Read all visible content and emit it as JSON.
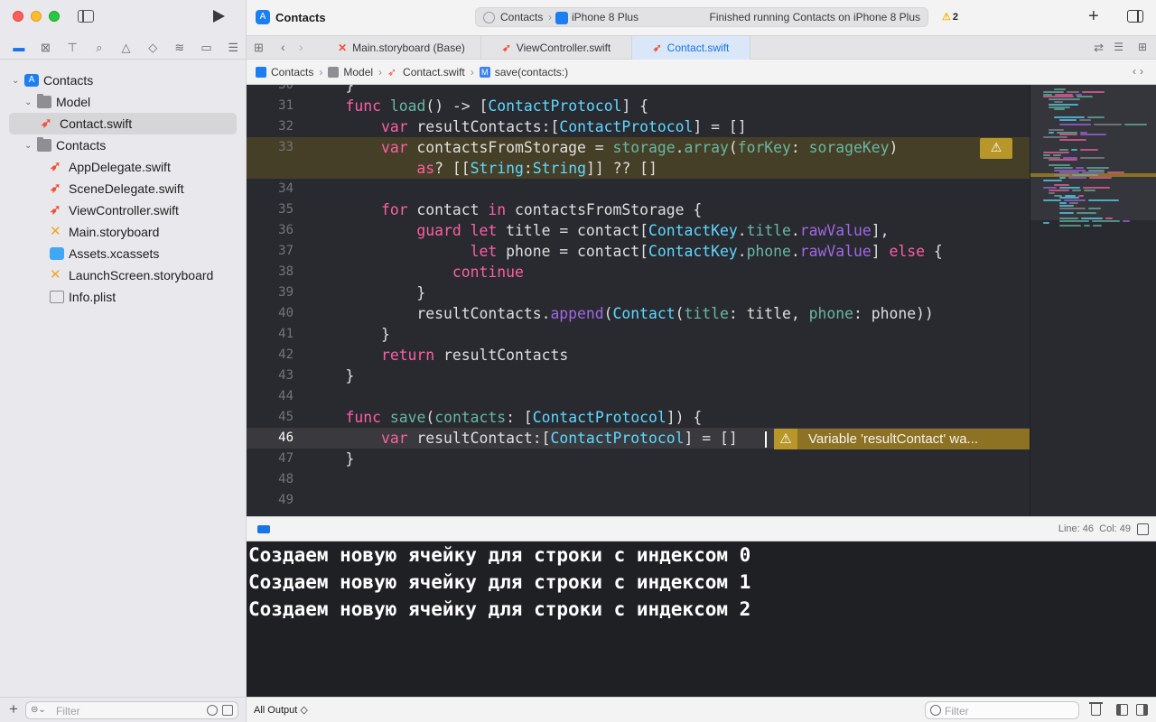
{
  "toolbar": {
    "project_title": "Contacts",
    "scheme": "Contacts",
    "device": "iPhone 8 Plus",
    "status": "Finished running Contacts on iPhone 8 Plus",
    "warning_count": "2"
  },
  "sidebar": {
    "nav_tabs": [
      "project-navigator",
      "source-control",
      "symbols",
      "find",
      "issues",
      "tests",
      "debug",
      "breakpoints",
      "reports"
    ],
    "tree": [
      {
        "label": "Contacts",
        "kind": "project",
        "indent": 0,
        "expanded": true
      },
      {
        "label": "Model",
        "kind": "folder",
        "indent": 1,
        "expanded": true
      },
      {
        "label": "Contact.swift",
        "kind": "swift",
        "indent": 2,
        "selected": true
      },
      {
        "label": "Contacts",
        "kind": "folder",
        "indent": 1,
        "expanded": true
      },
      {
        "label": "AppDelegate.swift",
        "kind": "swift",
        "indent": 2
      },
      {
        "label": "SceneDelegate.swift",
        "kind": "swift",
        "indent": 2
      },
      {
        "label": "ViewController.swift",
        "kind": "swift",
        "indent": 2
      },
      {
        "label": "Main.storyboard",
        "kind": "storyboard",
        "indent": 2
      },
      {
        "label": "Assets.xcassets",
        "kind": "assets",
        "indent": 2
      },
      {
        "label": "LaunchScreen.storyboard",
        "kind": "storyboard",
        "indent": 2
      },
      {
        "label": "Info.plist",
        "kind": "plist",
        "indent": 2
      }
    ],
    "filter_placeholder": "Filter"
  },
  "tabs": [
    {
      "label": "Main.storyboard (Base)",
      "kind": "storyboard"
    },
    {
      "label": "ViewController.swift",
      "kind": "swift"
    },
    {
      "label": "Contact.swift",
      "kind": "swift",
      "active": true
    }
  ],
  "jumpbar": {
    "crumbs": [
      "Contacts",
      "Model",
      "Contact.swift",
      "save(contacts:)"
    ]
  },
  "editor": {
    "lines": [
      {
        "n": "30",
        "code": [
          [
            "p",
            "    }"
          ]
        ]
      },
      {
        "n": "31",
        "code": [
          [
            "p",
            "    "
          ],
          [
            "kw",
            "func"
          ],
          [
            "p",
            " "
          ],
          [
            "fn",
            "load"
          ],
          [
            "p",
            "() -> ["
          ],
          [
            "ty",
            "ContactProtocol"
          ],
          [
            "p",
            "] {"
          ]
        ]
      },
      {
        "n": "32",
        "code": [
          [
            "p",
            "        "
          ],
          [
            "kw",
            "var"
          ],
          [
            "p",
            " resultContacts:["
          ],
          [
            "ty",
            "ContactProtocol"
          ],
          [
            "p",
            "] = []"
          ]
        ]
      },
      {
        "n": "33",
        "code": [
          [
            "p",
            "        "
          ],
          [
            "kw",
            "var"
          ],
          [
            "p",
            " contactsFromStorage = "
          ],
          [
            "fn",
            "storage"
          ],
          [
            "p",
            "."
          ],
          [
            "fn",
            "array"
          ],
          [
            "p",
            "("
          ],
          [
            "fn",
            "forKey"
          ],
          [
            "p",
            ": "
          ],
          [
            "fn",
            "sorageKey"
          ],
          [
            "p",
            ")"
          ]
        ],
        "warn": true
      },
      {
        "n": "",
        "code": [
          [
            "p",
            "            "
          ],
          [
            "kw",
            "as"
          ],
          [
            "p",
            "? [["
          ],
          [
            "ty",
            "String"
          ],
          [
            "p",
            ":"
          ],
          [
            "ty",
            "String"
          ],
          [
            "p",
            "]] ?? []"
          ]
        ],
        "warn": true
      },
      {
        "n": "34",
        "code": []
      },
      {
        "n": "35",
        "code": [
          [
            "p",
            "        "
          ],
          [
            "kw",
            "for"
          ],
          [
            "p",
            " contact "
          ],
          [
            "kw",
            "in"
          ],
          [
            "p",
            " contactsFromStorage {"
          ]
        ]
      },
      {
        "n": "36",
        "code": [
          [
            "p",
            "            "
          ],
          [
            "kw",
            "guard"
          ],
          [
            "p",
            " "
          ],
          [
            "kw",
            "let"
          ],
          [
            "p",
            " title = contact["
          ],
          [
            "ty",
            "ContactKey"
          ],
          [
            "p",
            "."
          ],
          [
            "fn",
            "title"
          ],
          [
            "p",
            "."
          ],
          [
            "me",
            "rawValue"
          ],
          [
            "p",
            "],"
          ]
        ]
      },
      {
        "n": "37",
        "code": [
          [
            "p",
            "                  "
          ],
          [
            "kw",
            "let"
          ],
          [
            "p",
            " phone = contact["
          ],
          [
            "ty",
            "ContactKey"
          ],
          [
            "p",
            "."
          ],
          [
            "fn",
            "phone"
          ],
          [
            "p",
            "."
          ],
          [
            "me",
            "rawValue"
          ],
          [
            "p",
            "] "
          ],
          [
            "kw",
            "else"
          ],
          [
            "p",
            " {"
          ]
        ]
      },
      {
        "n": "38",
        "code": [
          [
            "p",
            "                "
          ],
          [
            "kw",
            "continue"
          ]
        ]
      },
      {
        "n": "39",
        "code": [
          [
            "p",
            "            }"
          ]
        ]
      },
      {
        "n": "40",
        "code": [
          [
            "p",
            "            resultContacts."
          ],
          [
            "me",
            "append"
          ],
          [
            "p",
            "("
          ],
          [
            "ty",
            "Contact"
          ],
          [
            "p",
            "("
          ],
          [
            "fn",
            "title"
          ],
          [
            "p",
            ": title, "
          ],
          [
            "fn",
            "phone"
          ],
          [
            "p",
            ": phone))"
          ]
        ]
      },
      {
        "n": "41",
        "code": [
          [
            "p",
            "        }"
          ]
        ]
      },
      {
        "n": "42",
        "code": [
          [
            "p",
            "        "
          ],
          [
            "kw",
            "return"
          ],
          [
            "p",
            " resultContacts"
          ]
        ]
      },
      {
        "n": "43",
        "code": [
          [
            "p",
            "    }"
          ]
        ]
      },
      {
        "n": "44",
        "code": []
      },
      {
        "n": "45",
        "code": [
          [
            "p",
            "    "
          ],
          [
            "kw",
            "func"
          ],
          [
            "p",
            " "
          ],
          [
            "fn",
            "save"
          ],
          [
            "p",
            "("
          ],
          [
            "fn",
            "contacts"
          ],
          [
            "p",
            ": ["
          ],
          [
            "ty",
            "ContactProtocol"
          ],
          [
            "p",
            "]) {"
          ]
        ]
      },
      {
        "n": "46",
        "code": [
          [
            "p",
            "        "
          ],
          [
            "kw",
            "var"
          ],
          [
            "p",
            " resultContact:["
          ],
          [
            "ty",
            "ContactProtocol"
          ],
          [
            "p",
            "] = []"
          ]
        ],
        "current": true
      },
      {
        "n": "47",
        "code": [
          [
            "p",
            "    }"
          ]
        ]
      },
      {
        "n": "48",
        "code": []
      },
      {
        "n": "49",
        "code": []
      }
    ],
    "inline_warning": "Variable 'resultContact' wa...",
    "cursor_line": "Line: 46",
    "cursor_col": "Col: 49"
  },
  "console": {
    "lines": [
      "Создаем новую ячейку для строки с индексом 0",
      "Создаем новую ячейку для строки с индексом 1",
      "Создаем новую ячейку для строки с индексом 2"
    ],
    "output_select": "All Output ◇",
    "filter_placeholder": "Filter"
  },
  "colors": {
    "keyword": "#fc5fa3",
    "type": "#5dd8ff",
    "function": "#67b7a4",
    "method": "#a167e6",
    "warning": "#b8962a",
    "accent": "#1a73e8"
  }
}
